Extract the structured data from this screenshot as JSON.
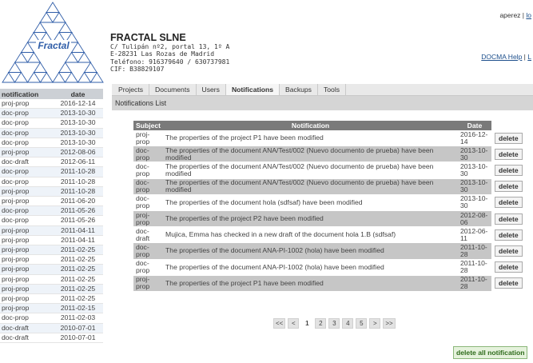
{
  "header": {
    "logo_text": "Fractal",
    "company_name": "FRACTAL SLNE",
    "address_line1": "C/ Tulipán nº2, portal 13, 1º A",
    "address_line2": "E-28231 Las Rozas de Madrid",
    "phone_line": "Teléfono: 916379640 / 630737981",
    "cif_line": "CIF: B38829107",
    "user": "aperez",
    "logout_label": "lo",
    "help_link": "DOCMA Help",
    "help_sep": "|",
    "help_link2": "L"
  },
  "sidebar": {
    "col_notification": "notification",
    "col_date": "date",
    "rows": [
      {
        "type": "proj-prop",
        "date": "2016-12-14"
      },
      {
        "type": "doc-prop",
        "date": "2013-10-30"
      },
      {
        "type": "doc-prop",
        "date": "2013-10-30"
      },
      {
        "type": "doc-prop",
        "date": "2013-10-30"
      },
      {
        "type": "doc-prop",
        "date": "2013-10-30"
      },
      {
        "type": "proj-prop",
        "date": "2012-08-06"
      },
      {
        "type": "doc-draft",
        "date": "2012-06-11"
      },
      {
        "type": "doc-prop",
        "date": "2011-10-28"
      },
      {
        "type": "doc-prop",
        "date": "2011-10-28"
      },
      {
        "type": "proj-prop",
        "date": "2011-10-28"
      },
      {
        "type": "proj-prop",
        "date": "2011-06-20"
      },
      {
        "type": "doc-prop",
        "date": "2011-05-26"
      },
      {
        "type": "doc-prop",
        "date": "2011-05-26"
      },
      {
        "type": "proj-prop",
        "date": "2011-04-11"
      },
      {
        "type": "proj-prop",
        "date": "2011-04-11"
      },
      {
        "type": "proj-prop",
        "date": "2011-02-25"
      },
      {
        "type": "proj-prop",
        "date": "2011-02-25"
      },
      {
        "type": "proj-prop",
        "date": "2011-02-25"
      },
      {
        "type": "proj-prop",
        "date": "2011-02-25"
      },
      {
        "type": "proj-prop",
        "date": "2011-02-25"
      },
      {
        "type": "proj-prop",
        "date": "2011-02-25"
      },
      {
        "type": "proj-prop",
        "date": "2011-02-15"
      },
      {
        "type": "doc-prop",
        "date": "2011-02-03"
      },
      {
        "type": "doc-draft",
        "date": "2010-07-01"
      },
      {
        "type": "doc-draft",
        "date": "2010-07-01"
      }
    ]
  },
  "tabs": [
    "Projects",
    "Documents",
    "Users",
    "Notifications",
    "Backups",
    "Tools"
  ],
  "active_tab": "Notifications",
  "list_title": "Notifications List",
  "table": {
    "col_subject": "Subject",
    "col_notification": "Notification",
    "col_date": "Date",
    "delete_label": "delete",
    "rows": [
      {
        "subject": "proj- prop",
        "text": "The properties of the project P1 have been modified",
        "date": "2016-12- 14"
      },
      {
        "subject": "doc- prop",
        "text": "The properties of the document ANA/Test/002 (Nuevo documento de prueba) have been modified",
        "date": "2013-10- 30"
      },
      {
        "subject": "doc- prop",
        "text": "The properties of the document ANA/Test/002 (Nuevo documento de prueba) have been modified",
        "date": "2013-10- 30"
      },
      {
        "subject": "doc- prop",
        "text": "The properties of the document ANA/Test/002 (Nuevo documento de prueba) have been modified",
        "date": "2013-10- 30"
      },
      {
        "subject": "doc- prop",
        "text": "The properties of the document hola (sdfsaf) have been modified",
        "date": "2013-10- 30"
      },
      {
        "subject": "proj- prop",
        "text": "The properties of the project P2 have been modified",
        "date": "2012-08- 06"
      },
      {
        "subject": "doc- draft",
        "text": "Mujica, Emma has checked in a new draft of the document hola 1.B (sdfsaf)",
        "date": "2012-06- 11"
      },
      {
        "subject": "doc- prop",
        "text": "The properties of the document ANA-PI-1002 (hola) have been modified",
        "date": "2011-10- 28"
      },
      {
        "subject": "doc- prop",
        "text": "The properties of the document ANA-PI-1002 (hola) have been modified",
        "date": "2011-10- 28"
      },
      {
        "subject": "proj- prop",
        "text": "The properties of the project P1 have been modified",
        "date": "2011-10- 28"
      }
    ]
  },
  "pager": {
    "first": "<<",
    "prev": "<",
    "pages": [
      "1",
      "2",
      "3",
      "4",
      "5"
    ],
    "current": "1",
    "next": ">",
    "last": ">>"
  },
  "delete_all_label": "delete all notification"
}
